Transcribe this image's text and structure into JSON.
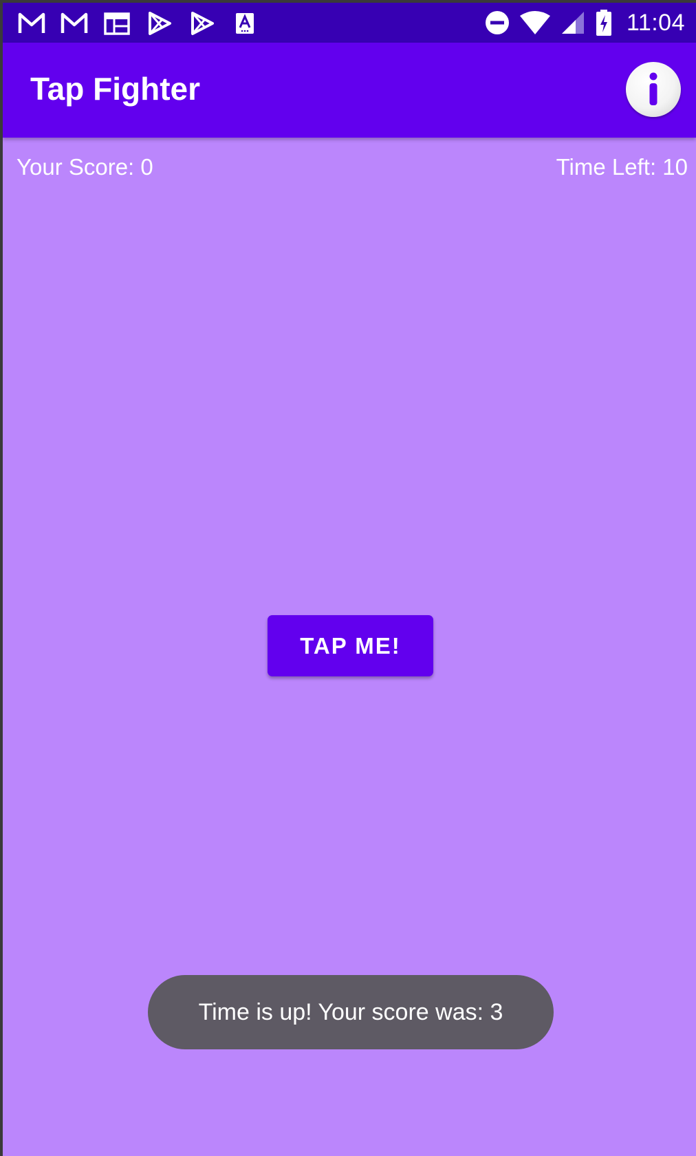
{
  "status_bar": {
    "time": "11:04",
    "left_icons": [
      "gmail-icon",
      "gmail-icon",
      "calendar-icon",
      "play-store-icon",
      "play-store-icon",
      "font-app-icon"
    ],
    "right_icons": [
      "do-not-disturb-icon",
      "wifi-icon",
      "signal-icon",
      "battery-charging-icon"
    ],
    "background_color": "#3700b3"
  },
  "app_bar": {
    "title": "Tap Fighter",
    "action_icon": "info-icon",
    "background_color": "#6200ee"
  },
  "game": {
    "score_text": "Your Score: 0",
    "time_text": "Time Left: 10",
    "tap_button_label": "TAP ME!",
    "background_color": "#bb86fc"
  },
  "toast": {
    "message": "Time is up! Your score was: 3"
  }
}
